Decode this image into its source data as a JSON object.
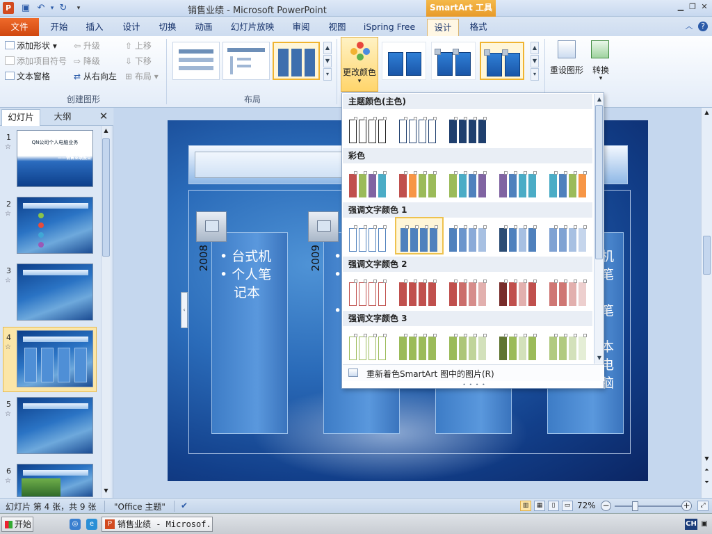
{
  "titlebar": {
    "app_icon": "P",
    "title": "销售业绩 - Microsoft PowerPoint",
    "smartart_tools": "SmartArt 工具"
  },
  "tabs": {
    "file": "文件",
    "home": "开始",
    "insert": "插入",
    "design": "设计",
    "transitions": "切换",
    "animations": "动画",
    "slideshow": "幻灯片放映",
    "review": "审阅",
    "view": "视图",
    "ispring": "iSpring Free",
    "sa_design": "设计",
    "sa_format": "格式"
  },
  "ribbon": {
    "create": {
      "add_shape": "添加形状",
      "add_bullet": "添加项目符号",
      "text_pane": "文本窗格",
      "promote": "升级",
      "demote": "降级",
      "right_to_left": "从右向左",
      "move_up": "上移",
      "move_down": "下移",
      "layout": "布局",
      "group_label": "创建图形"
    },
    "layouts_label": "布局",
    "change_colors": "更改颜色",
    "reset_graphic": "重设图形",
    "convert": "转换"
  },
  "pane": {
    "tab_slides": "幻灯片",
    "tab_outline": "大纲",
    "slides": [
      {
        "num": "1",
        "title": "QN公司个人电脑业务",
        "subtitle": "——销售业绩报告"
      },
      {
        "num": "2"
      },
      {
        "num": "3"
      },
      {
        "num": "4"
      },
      {
        "num": "5"
      },
      {
        "num": "6"
      }
    ]
  },
  "slide": {
    "columns": [
      {
        "year": "2008",
        "items": [
          "台式机",
          "个人笔",
          "记本"
        ]
      },
      {
        "year": "2009"
      }
    ],
    "right_col_text": [
      "机",
      "笔",
      "",
      "笔",
      "",
      "本",
      "电",
      "脑"
    ]
  },
  "dropdown": {
    "sections": [
      {
        "label": "主题颜色(主色)"
      },
      {
        "label": "彩色"
      },
      {
        "label": "强调文字颜色 1"
      },
      {
        "label": "强调文字颜色 2"
      },
      {
        "label": "强调文字颜色 3"
      }
    ],
    "footer": "重新着色SmartArt 图中的图片(R)"
  },
  "statusbar": {
    "slide_info": "幻灯片 第 4 张，共 9 张",
    "theme": "\"Office 主题\"",
    "zoom": "72%"
  },
  "taskbar": {
    "start": "开始",
    "task": "销售业绩 - Microsof...",
    "ime": "CH"
  },
  "colors": {
    "accent_orange": "#e79a2a",
    "file_tab": "#cf4710",
    "selected_border": "#f0b430"
  }
}
